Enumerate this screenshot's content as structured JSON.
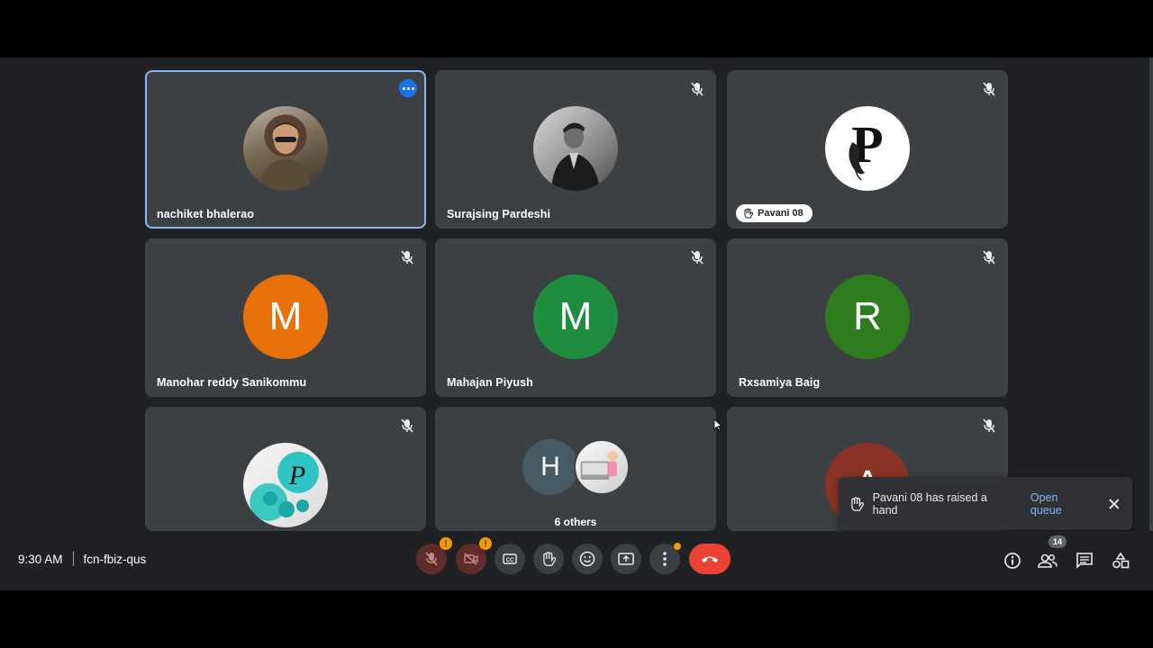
{
  "meeting": {
    "time": "9:30 AM",
    "code": "fcn-fbiz-qus",
    "participant_count": "14"
  },
  "tiles": [
    {
      "name": "nachiket bhalerao",
      "avatar_type": "photo",
      "active": true
    },
    {
      "name": "Surajsing Pardeshi",
      "avatar_type": "photo"
    },
    {
      "name": "Pavani 08",
      "avatar_type": "image",
      "hand_raised": true
    },
    {
      "name": "Manohar reddy Sanikommu",
      "avatar_letter": "M",
      "avatar_color": "#e8710a"
    },
    {
      "name": "Mahajan Piyush",
      "avatar_letter": "M",
      "avatar_color": "#1e8e3e"
    },
    {
      "name": "Rxsamiya Baig",
      "avatar_letter": "R",
      "avatar_color": "#2d7d1f"
    },
    {
      "name": "",
      "avatar_type": "image"
    },
    {
      "name": "6 others",
      "avatar_letter": "H",
      "avatar_color": "#455a64"
    },
    {
      "name": "",
      "avatar_letter": "A",
      "avatar_color": "#8a3324"
    }
  ],
  "toast": {
    "message": "Pavani 08 has raised a hand",
    "action": "Open queue"
  },
  "icons": {
    "mic": "mic-off-icon",
    "camera": "camera-off-icon",
    "captions": "captions-icon",
    "hand": "raise-hand-icon",
    "emoji": "emoji-icon",
    "present": "present-icon",
    "more": "more-vert-icon",
    "end": "end-call-icon",
    "info": "info-icon",
    "people": "people-icon",
    "chat": "chat-icon",
    "activities": "activities-icon"
  }
}
